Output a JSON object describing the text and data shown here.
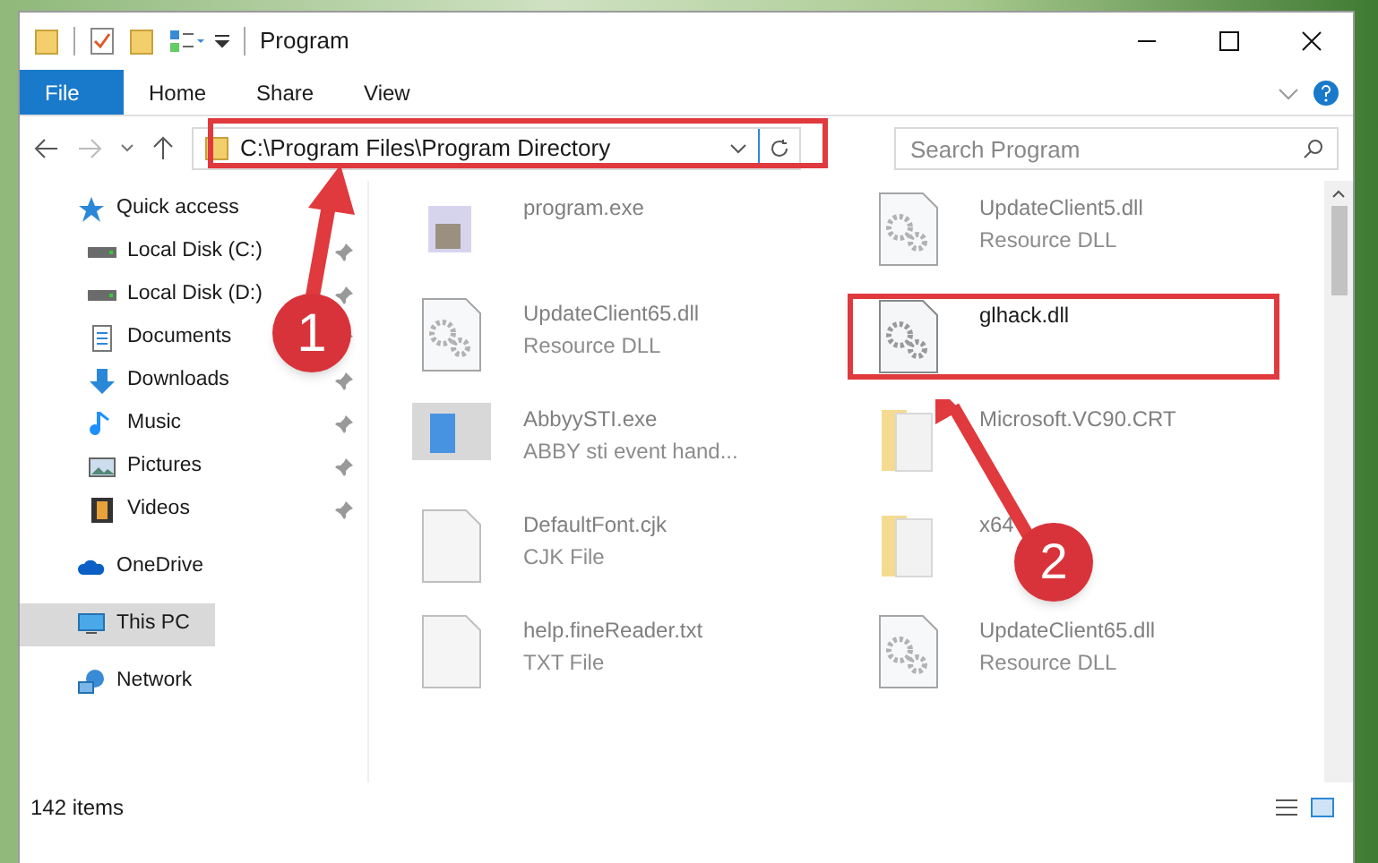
{
  "window": {
    "title": "Program"
  },
  "ribbon_tabs": [
    {
      "label": "File",
      "selected": true
    },
    {
      "label": "Home",
      "selected": false
    },
    {
      "label": "Share",
      "selected": false
    },
    {
      "label": "View",
      "selected": false
    }
  ],
  "address_bar": {
    "value": "C:\\Program Files\\Program Directory"
  },
  "search": {
    "placeholder": "Search Program"
  },
  "sidebar": {
    "items": [
      {
        "label": "Quick access",
        "kind": "star",
        "selected": false,
        "children": [
          {
            "label": "Local Disk (C:)",
            "kind": "drive",
            "pinned": true,
            "selected": false
          },
          {
            "label": "Local Disk (D:)",
            "kind": "drive",
            "pinned": true,
            "selected": false
          },
          {
            "label": "Documents",
            "kind": "document",
            "pinned": true,
            "selected": false
          },
          {
            "label": "Downloads",
            "kind": "download",
            "pinned": true,
            "selected": false
          },
          {
            "label": "Music",
            "kind": "music",
            "pinned": true,
            "selected": false
          },
          {
            "label": "Pictures",
            "kind": "picture",
            "pinned": true,
            "selected": false
          },
          {
            "label": "Videos",
            "kind": "video",
            "pinned": true,
            "selected": false
          }
        ]
      },
      {
        "label": "OneDrive",
        "kind": "cloud",
        "selected": false
      },
      {
        "label": "This PC",
        "kind": "pc",
        "selected": true
      },
      {
        "label": "Network",
        "kind": "network",
        "selected": false
      }
    ]
  },
  "files": [
    {
      "name": "program.exe",
      "kind": "exe",
      "dimmed": true,
      "highlighted": false
    },
    {
      "name": "UpdateClient5.dll",
      "type": "Resource DLL",
      "kind": "dll",
      "dimmed": true,
      "highlighted": false
    },
    {
      "name": "UpdateClient65.dll",
      "type": "Resource DLL",
      "kind": "dll",
      "dimmed": true,
      "highlighted": false
    },
    {
      "name": "glhack.dll",
      "kind": "dll",
      "dimmed": false,
      "highlighted": true
    },
    {
      "name": "AbbyySTI.exe",
      "type": "ABBY sti event hand...",
      "kind": "app",
      "dimmed": true,
      "highlighted": false
    },
    {
      "name": "Microsoft.VC90.CRT",
      "kind": "folder",
      "dimmed": true,
      "highlighted": false
    },
    {
      "name": "DefaultFont.cjk",
      "type": "CJK File",
      "kind": "file",
      "dimmed": true,
      "highlighted": false
    },
    {
      "name": "x64",
      "kind": "folder",
      "dimmed": true,
      "highlighted": false
    },
    {
      "name": "help.fineReader.txt",
      "type": "TXT File",
      "kind": "file",
      "dimmed": true,
      "highlighted": false
    },
    {
      "name": "UpdateClient65.dll",
      "type": "Resource DLL",
      "kind": "dll",
      "dimmed": true,
      "highlighted": false
    }
  ],
  "status_bar": {
    "count": "142 items"
  },
  "annotations": [
    {
      "label": "1"
    },
    {
      "label": "2"
    }
  ]
}
